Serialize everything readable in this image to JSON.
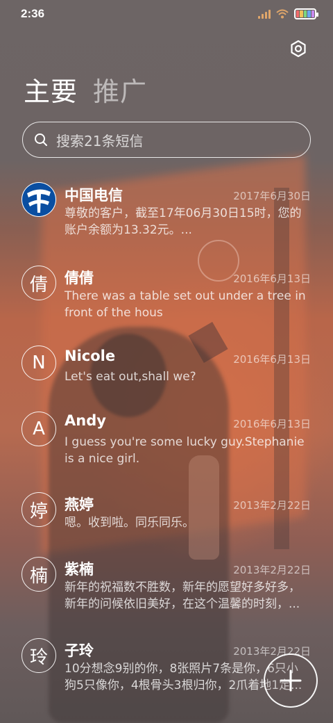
{
  "status_bar": {
    "time": "2:36",
    "signal_icon": "signal-bars-icon",
    "wifi_icon": "wifi-icon",
    "battery_icon": "battery-icon"
  },
  "header": {
    "settings_icon": "gear-icon",
    "tabs": [
      {
        "label": "主要",
        "active": true
      },
      {
        "label": "推广",
        "active": false
      }
    ]
  },
  "search": {
    "icon": "search-icon",
    "placeholder": "搜索21条短信"
  },
  "messages": [
    {
      "avatar": "",
      "avatar_icon": "china-telecom-logo",
      "name": "中国电信",
      "date": "2017年6月30日",
      "preview": "尊敬的客户，截至17年06月30日15时，您的账户余额为13.32元。..."
    },
    {
      "avatar": "倩",
      "name": "倩倩",
      "date": "2016年6月13日",
      "preview": "There was a table set out under a tree in front of the hous"
    },
    {
      "avatar": "N",
      "name": "Nicole",
      "date": "2016年6月13日",
      "preview": "Let's eat out,shall we?"
    },
    {
      "avatar": "A",
      "name": "Andy",
      "date": "2016年6月13日",
      "preview": "I guess you're some lucky guy.Stephanie is a nice girl."
    },
    {
      "avatar": "婷",
      "name": "燕婷",
      "date": "2013年2月22日",
      "preview": "嗯。收到啦。同乐同乐。"
    },
    {
      "avatar": "楠",
      "name": "紫楠",
      "date": "2013年2月22日",
      "preview": "新年的祝福数不胜数，新年的愿望好多好多，新年的问候依旧美好，在这个温馨的时刻，..."
    },
    {
      "avatar": "玲",
      "name": "子玲",
      "date": "2013年2月22日",
      "preview": "10分想念9别的你，8张照片7条是你，6只小狗5只像你，4根骨头3根归你，2爪着地1定..."
    }
  ],
  "fab": {
    "icon": "plus-icon"
  },
  "colors": {
    "accent_orange": "#b8664a",
    "background_gray": "#6d6464",
    "brand_blue": "#0a4ea1"
  }
}
